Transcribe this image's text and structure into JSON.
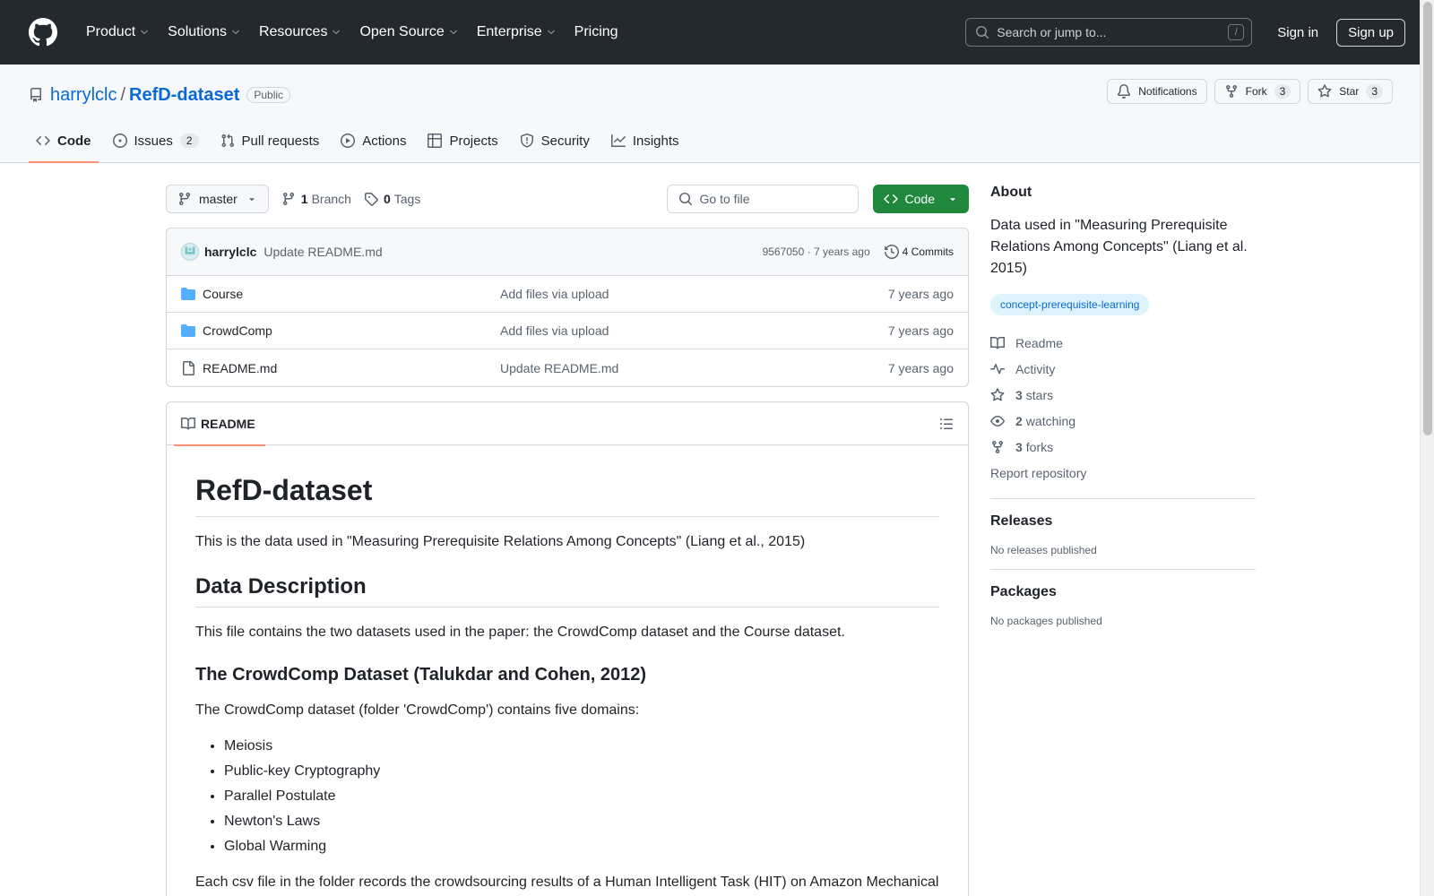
{
  "header": {
    "nav": [
      "Product",
      "Solutions",
      "Resources",
      "Open Source",
      "Enterprise",
      "Pricing"
    ],
    "search_placeholder": "Search or jump to...",
    "search_shortcut": "/",
    "sign_in": "Sign in",
    "sign_up": "Sign up"
  },
  "repo": {
    "owner": "harrylclc",
    "separator": "/",
    "name": "RefD-dataset",
    "visibility": "Public",
    "notifications_label": "Notifications",
    "fork_label": "Fork",
    "fork_count": "3",
    "star_label": "Star",
    "star_count": "3"
  },
  "tabs": [
    {
      "label": "Code",
      "icon": "code-icon"
    },
    {
      "label": "Issues",
      "count": "2",
      "icon": "issue-icon"
    },
    {
      "label": "Pull requests",
      "icon": "pull-request-icon"
    },
    {
      "label": "Actions",
      "icon": "play-icon"
    },
    {
      "label": "Projects",
      "icon": "table-icon"
    },
    {
      "label": "Security",
      "icon": "shield-icon"
    },
    {
      "label": "Insights",
      "icon": "graph-icon"
    }
  ],
  "toolbar": {
    "branch": "master",
    "branch_count": "1",
    "branch_label": "Branch",
    "tag_count": "0",
    "tag_label": "Tags",
    "goto_placeholder": "Go to file",
    "code_button": "Code"
  },
  "commit": {
    "author": "harrylclc",
    "message": "Update README.md",
    "meta": "9567050 · 7 years ago",
    "commits": "4 Commits"
  },
  "files": [
    {
      "name": "Course",
      "type": "folder",
      "message": "Add files via upload",
      "time": "7 years ago"
    },
    {
      "name": "CrowdComp",
      "type": "folder",
      "message": "Add files via upload",
      "time": "7 years ago"
    },
    {
      "name": "README.md",
      "type": "file",
      "message": "Update README.md",
      "time": "7 years ago"
    }
  ],
  "readme": {
    "tab_label": "README",
    "h1": "RefD-dataset",
    "intro": "This is the data used in \"Measuring Prerequisite Relations Among Concepts\" (Liang et al., 2015)",
    "h2": "Data Description",
    "desc": "This file contains the two datasets used in the paper: the CrowdComp dataset and the Course dataset.",
    "h3": "The CrowdComp Dataset (Talukdar and Cohen, 2012)",
    "crowd_intro": "The CrowdComp dataset (folder 'CrowdComp') contains five domains:",
    "domains": [
      "Meiosis",
      "Public-key Cryptography",
      "Parallel Postulate",
      "Newton's Laws",
      "Global Warming"
    ],
    "csv_text": "Each csv file in the folder records the crowdsourcing results of a Human Intelligent Task (HIT) on Amazon Mechanical"
  },
  "about": {
    "heading": "About",
    "description": "Data used in \"Measuring Prerequisite Relations Among Concepts\" (Liang et al. 2015)",
    "topic": "concept-prerequisite-learning",
    "readme": "Readme",
    "activity": "Activity",
    "stars_n": "3",
    "stars": "stars",
    "watching_n": "2",
    "watching": "watching",
    "forks_n": "3",
    "forks": "forks",
    "report": "Report repository"
  },
  "releases": {
    "heading": "Releases",
    "empty": "No releases published"
  },
  "packages": {
    "heading": "Packages",
    "empty": "No packages published"
  }
}
